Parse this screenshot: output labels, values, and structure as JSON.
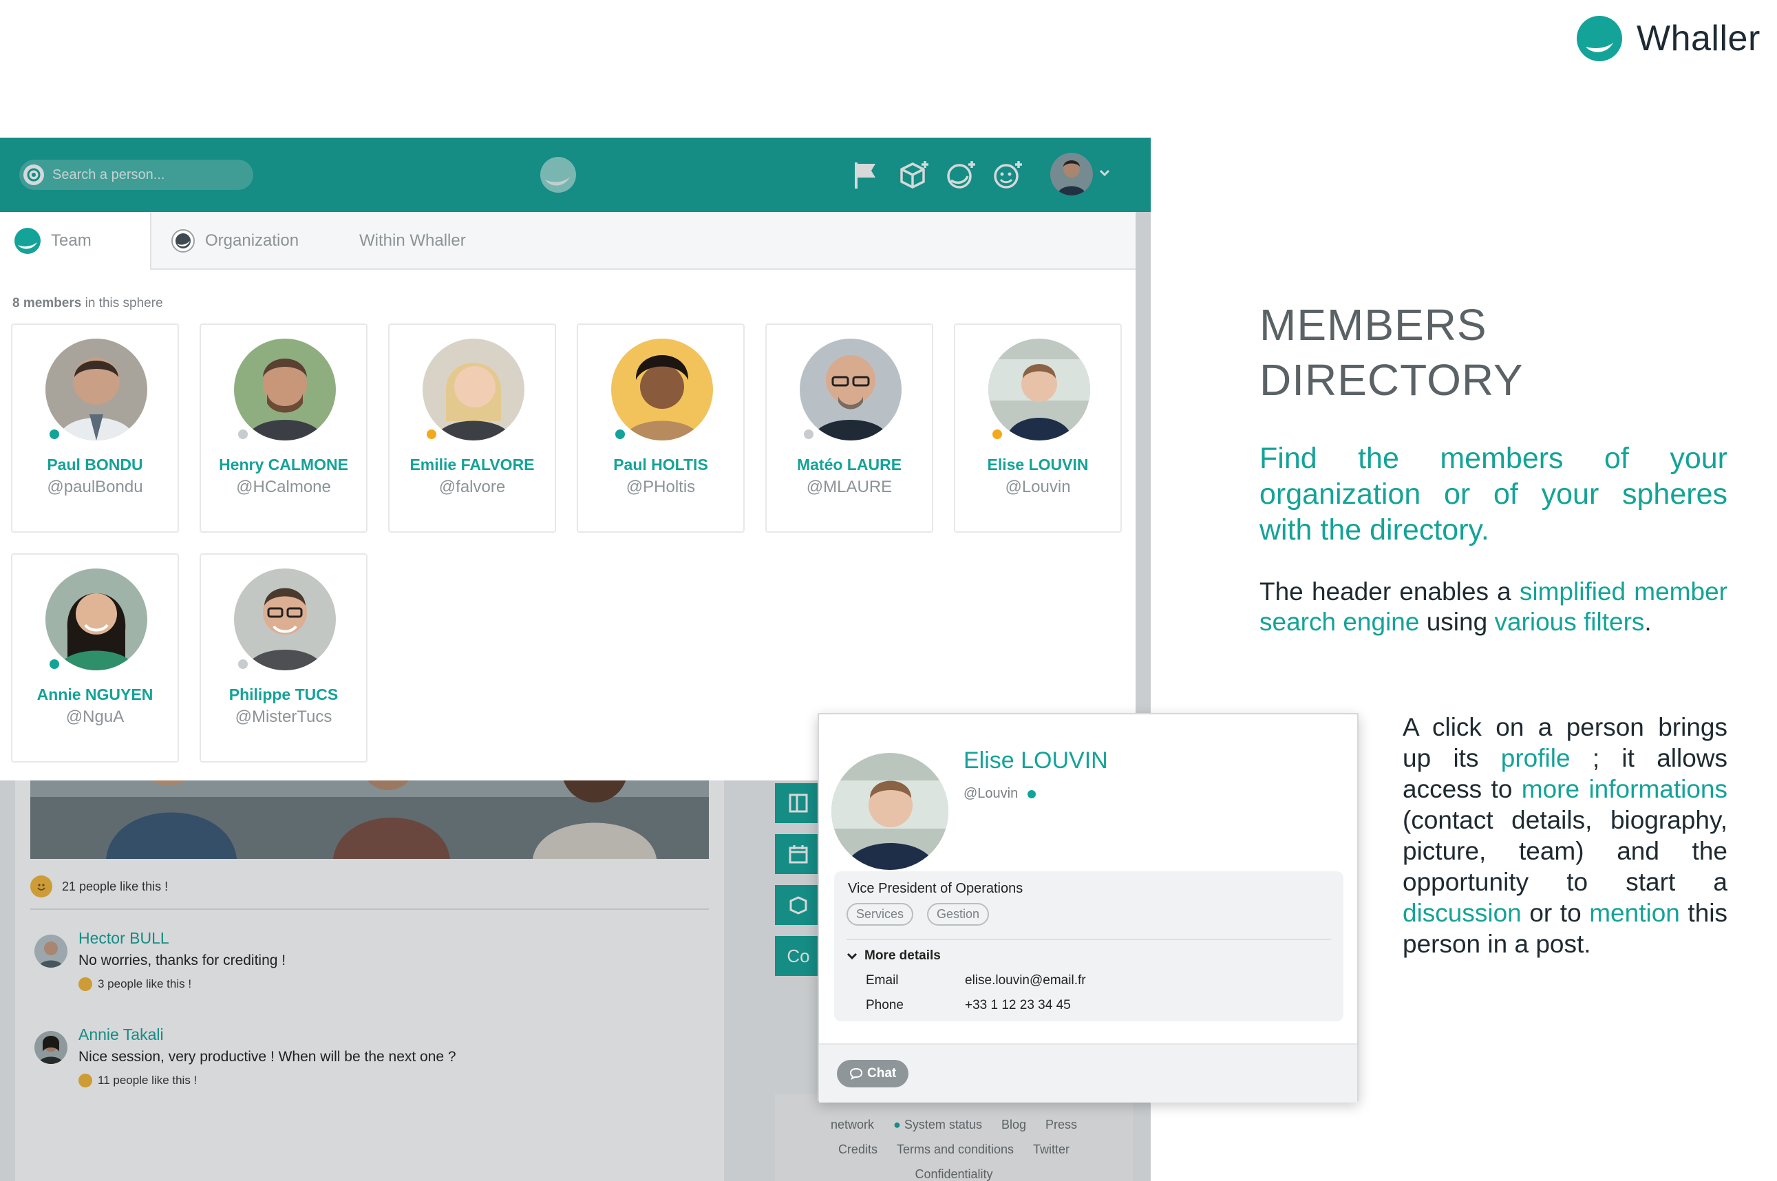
{
  "brand": {
    "name": "Whaller"
  },
  "header": {
    "search_placeholder": "Search a person..."
  },
  "tabs": [
    {
      "label": "Team"
    },
    {
      "label": "Organization"
    },
    {
      "label": "Within Whaller"
    }
  ],
  "directory": {
    "count_bold": "8 members",
    "count_rest": " in this sphere",
    "members": [
      {
        "name": "Paul BONDU",
        "handle": "@paulBondu",
        "status_color": "#14a398"
      },
      {
        "name": "Henry CALMONE",
        "handle": "@HCalmone",
        "status_color": "#c8ccce"
      },
      {
        "name": "Emilie FALVORE",
        "handle": "@falvore",
        "status_color": "#f4a91b"
      },
      {
        "name": "Paul HOLTIS",
        "handle": "@PHoltis",
        "status_color": "#14a398"
      },
      {
        "name": "Matéo LAURE",
        "handle": "@MLAURE",
        "status_color": "#c8ccce"
      },
      {
        "name": "Elise LOUVIN",
        "handle": "@Louvin",
        "status_color": "#f4a91b"
      },
      {
        "name": "Annie NGUYEN",
        "handle": "@NguA",
        "status_color": "#14a398"
      },
      {
        "name": "Philippe TUCS",
        "handle": "@MisterTucs",
        "status_color": "#c8ccce"
      }
    ]
  },
  "feed": {
    "post_likes": "21 people like this !",
    "comments": [
      {
        "name": "Hector BULL",
        "text": "No worries, thanks for crediting !",
        "likes": "3 people like this !"
      },
      {
        "name": "Annie Takali",
        "text": "Nice session, very productive ! When will be the next one ?",
        "likes": "11 people like this !"
      }
    ],
    "side_label": "Co",
    "footer_row1": [
      "network",
      "System status",
      "Blog",
      "Press"
    ],
    "footer_row2": [
      "Credits",
      "Terms and conditions",
      "Twitter"
    ],
    "footer_row3": [
      "Confidentiality"
    ]
  },
  "profile": {
    "name": "Elise LOUVIN",
    "handle": "@Louvin",
    "role": "Vice President of Operations",
    "tags": [
      "Services",
      "Gestion"
    ],
    "more_details": "More details",
    "email_label": "Email",
    "email": "elise.louvin@email.fr",
    "phone_label": "Phone",
    "phone": "+33 1 12 23 34 45",
    "chat": "Chat"
  },
  "text": {
    "heading_line1": "MEMBERS",
    "heading_line2": "DIRECTORY",
    "lead": "Find the members of your organization or of your spheres with the directory.",
    "p1_a": "The header enables a ",
    "p1_b": "simplified member search engine",
    "p1_c": " using ",
    "p1_d": "various filters",
    "p1_e": ".",
    "p2_a": "A click on a person brings up its ",
    "p2_b": "profile",
    "p2_c": " ; it allows access to ",
    "p2_d": "more informations",
    "p2_e": " (contact details, biography, picture, team) and the opportunity to start a ",
    "p2_f": "discussion",
    "p2_g": " or to ",
    "p2_h": "mention",
    "p2_i": " this person in a post."
  }
}
